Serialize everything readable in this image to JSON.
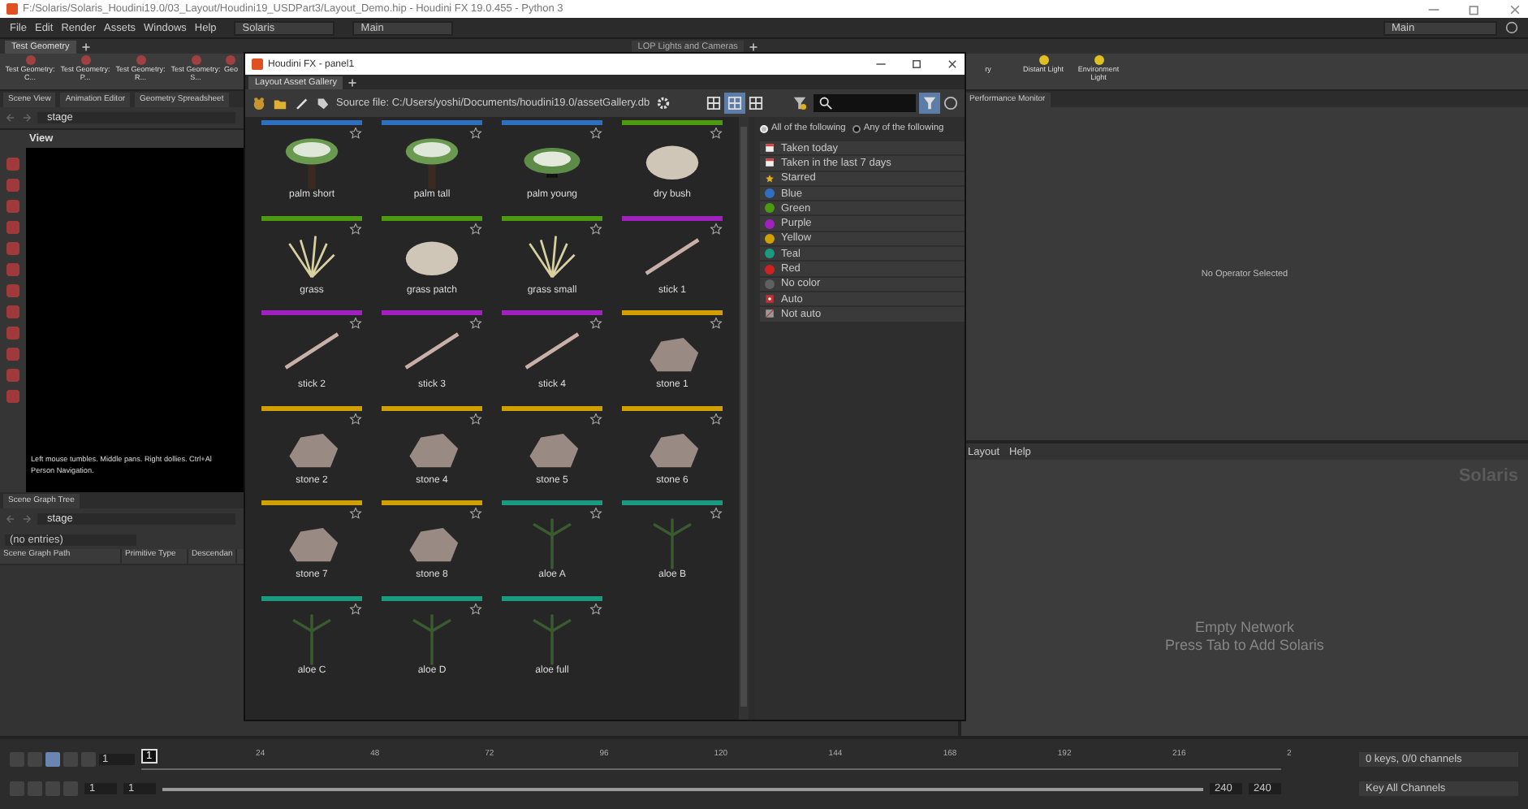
{
  "window": {
    "title": "F:/Solaris/Solaris_Houdini19.0/03_Layout/Houdini19_USDPart3/Layout_Demo.hip - Houdini FX 19.0.455 - Python 3"
  },
  "menu": [
    "File",
    "Edit",
    "Render",
    "Assets",
    "Windows",
    "Help"
  ],
  "desktop": "Solaris",
  "network_view": "Main",
  "right_view": "Main",
  "shelf_tabs": [
    {
      "label": "Test Geometry",
      "selected": true
    },
    {
      "label": "LOP Lights and Cameras",
      "selected": false
    }
  ],
  "shelf_left": [
    "Test Geometry: C...",
    "Test Geometry: P...",
    "Test Geometry: R...",
    "Test Geometry: S...",
    "Geo"
  ],
  "shelf_right": [
    "ry",
    "Distant Light",
    "Environment Light"
  ],
  "pane_tabs_left": [
    "Scene View",
    "Animation Editor",
    "Geometry Spreadsheet"
  ],
  "pane_tabs_right": [
    "Performance Monitor"
  ],
  "scene_view": {
    "path": "stage",
    "title": "View",
    "hint": "Left mouse tumbles. Middle pans. Right dollies. Ctrl+Al",
    "hint_line2": "Person Navigation."
  },
  "scene_graph": {
    "tab": "Scene Graph Tree",
    "path": "stage",
    "dropdown": "(no entries)",
    "columns": [
      "Scene Graph Path",
      "Primitive Type",
      "Descendan"
    ]
  },
  "parameters": {
    "message": "No Operator Selected"
  },
  "network": {
    "menu": [
      "Layout",
      "Help"
    ],
    "context": "Solaris",
    "empty_title": "Empty Network",
    "empty_hint": "Press Tab to Add Solaris"
  },
  "gallery_window": {
    "title": "Houdini FX - panel1",
    "tab": "Layout Asset Gallery",
    "source": "Source file: C:/Users/yoshi/Documents/houdini19.0/assetGallery.db",
    "view_modes": [
      {
        "selected": false
      },
      {
        "selected": true
      },
      {
        "selected": false
      }
    ],
    "assets": [
      {
        "name": "palm short",
        "kind": "palm",
        "color": "#2f6fc0"
      },
      {
        "name": "palm tall",
        "kind": "palm",
        "color": "#2f6fc0"
      },
      {
        "name": "palm young",
        "kind": "bush",
        "color": "#2f6fc0"
      },
      {
        "name": "dry bush",
        "kind": "drybush",
        "color": "#4c9a10"
      },
      {
        "name": "grass",
        "kind": "grass",
        "color": "#4c9a10"
      },
      {
        "name": "grass patch",
        "kind": "drybush",
        "color": "#4c9a10"
      },
      {
        "name": "grass small",
        "kind": "grass",
        "color": "#4c9a10"
      },
      {
        "name": "stick 1",
        "kind": "stick",
        "color": "#a020c0"
      },
      {
        "name": "stick 2",
        "kind": "stick",
        "color": "#a020c0"
      },
      {
        "name": "stick 3",
        "kind": "stick",
        "color": "#a020c0"
      },
      {
        "name": "stick 4",
        "kind": "stick",
        "color": "#a020c0"
      },
      {
        "name": "stone 1",
        "kind": "stone",
        "color": "#d0a000"
      },
      {
        "name": "stone 2",
        "kind": "stone",
        "color": "#d0a000"
      },
      {
        "name": "stone 4",
        "kind": "stone",
        "color": "#d0a000"
      },
      {
        "name": "stone 5",
        "kind": "stone",
        "color": "#d0a000"
      },
      {
        "name": "stone 6",
        "kind": "stone",
        "color": "#d0a000"
      },
      {
        "name": "stone 7",
        "kind": "stone",
        "color": "#d0a000"
      },
      {
        "name": "stone 8",
        "kind": "stone",
        "color": "#d0a000"
      },
      {
        "name": "aloe A",
        "kind": "aloe",
        "color": "#1a9a80"
      },
      {
        "name": "aloe B",
        "kind": "aloe",
        "color": "#1a9a80"
      },
      {
        "name": "aloe C",
        "kind": "aloe",
        "color": "#1a9a80"
      },
      {
        "name": "aloe D",
        "kind": "aloe",
        "color": "#1a9a80"
      },
      {
        "name": "aloe full",
        "kind": "aloe",
        "color": "#1a9a80"
      }
    ],
    "match": [
      {
        "label": "All of the following",
        "selected": true
      },
      {
        "label": "Any of the following",
        "selected": false
      }
    ],
    "filters": [
      {
        "label": "Taken today",
        "kind": "date"
      },
      {
        "label": "Taken in the last 7 days",
        "kind": "date"
      },
      {
        "label": "Starred",
        "kind": "starred"
      },
      {
        "label": "Blue",
        "kind": "color",
        "color": "#2f6fc0"
      },
      {
        "label": "Green",
        "kind": "color",
        "color": "#4c9a10"
      },
      {
        "label": "Purple",
        "kind": "color",
        "color": "#a020c0"
      },
      {
        "label": "Yellow",
        "kind": "color",
        "color": "#d0a000"
      },
      {
        "label": "Teal",
        "kind": "color",
        "color": "#1a9a80"
      },
      {
        "label": "Red",
        "kind": "color",
        "color": "#d02020"
      },
      {
        "label": "No color",
        "kind": "color",
        "color": "#606060"
      },
      {
        "label": "Auto",
        "kind": "auto"
      },
      {
        "label": "Not auto",
        "kind": "notauto"
      }
    ]
  },
  "timeline": {
    "current_frame": "1",
    "frame_field": "1",
    "ticks": [
      "24",
      "48",
      "72",
      "96",
      "120",
      "144",
      "168",
      "192",
      "216",
      "2"
    ],
    "start": "1",
    "range_start": "1",
    "range_end": "240",
    "range": {
      "level": 1
    },
    "end": "240",
    "keys": "0 keys, 0/0 channels",
    "key_mode": "Key All Channels"
  }
}
